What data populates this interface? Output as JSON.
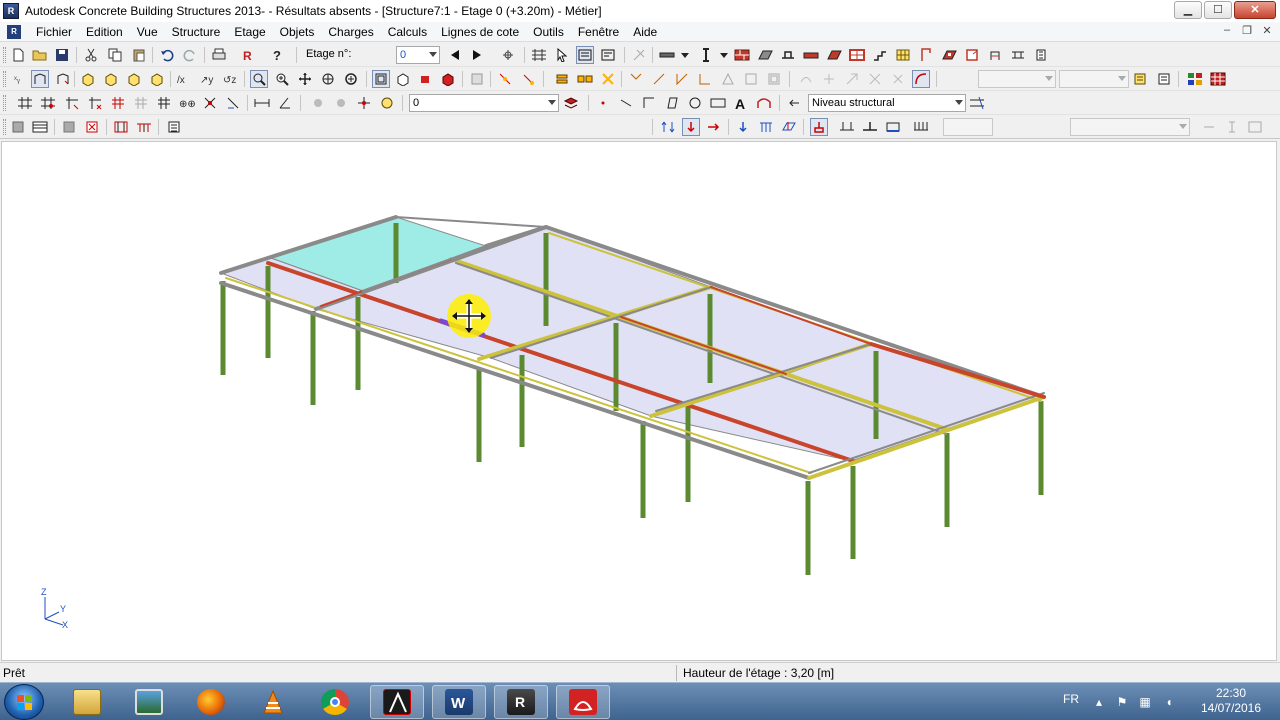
{
  "window": {
    "title": "Autodesk Concrete Building Structures 2013- - Résultats absents - [Structure7:1 - Etage 0 (+3.20m) - Métier]",
    "app_icon_text": "R",
    "doc_icon_text": "R",
    "minimize": "▁",
    "maximize": "☐",
    "close": "✕"
  },
  "menubar": {
    "items": [
      "Fichier",
      "Edition",
      "Vue",
      "Structure",
      "Etage",
      "Objets",
      "Charges",
      "Calculs",
      "Lignes de cote",
      "Outils",
      "Fenêtre",
      "Aide"
    ],
    "mdi_minimize": "–",
    "mdi_restore": "❐",
    "mdi_close": "✕"
  },
  "toolbar1": {
    "etage_label": "Etage n°:",
    "etage_value": "0"
  },
  "toolbar3": {
    "layer_value": "0",
    "level_value": "Niveau structural"
  },
  "viewport": {
    "axis_z": "Z",
    "axis_y": "Y",
    "axis_x": "X",
    "cursor": "pan-cursor-icon"
  },
  "status": {
    "left": "Prêt",
    "right": "Hauteur de l'étage : 3,20 [m]"
  },
  "taskbar": {
    "apps": [
      "file-explorer-icon",
      "picture-viewer-icon",
      "firefox-icon",
      "vlc-icon",
      "chrome-icon",
      "autocad-icon",
      "word-icon",
      "robot-cbs-icon",
      "acrobat-icon"
    ],
    "lang": "FR",
    "time": "22:30",
    "date": "14/07/2016"
  },
  "colors": {
    "slab_fill": "#c9c9ee",
    "highlight_slab": "#7fe5dd",
    "column": "#6b9a3e",
    "beam_red": "#c8442a",
    "beam_yellow": "#cdc23c",
    "beam_grey": "#8a8a8a"
  }
}
